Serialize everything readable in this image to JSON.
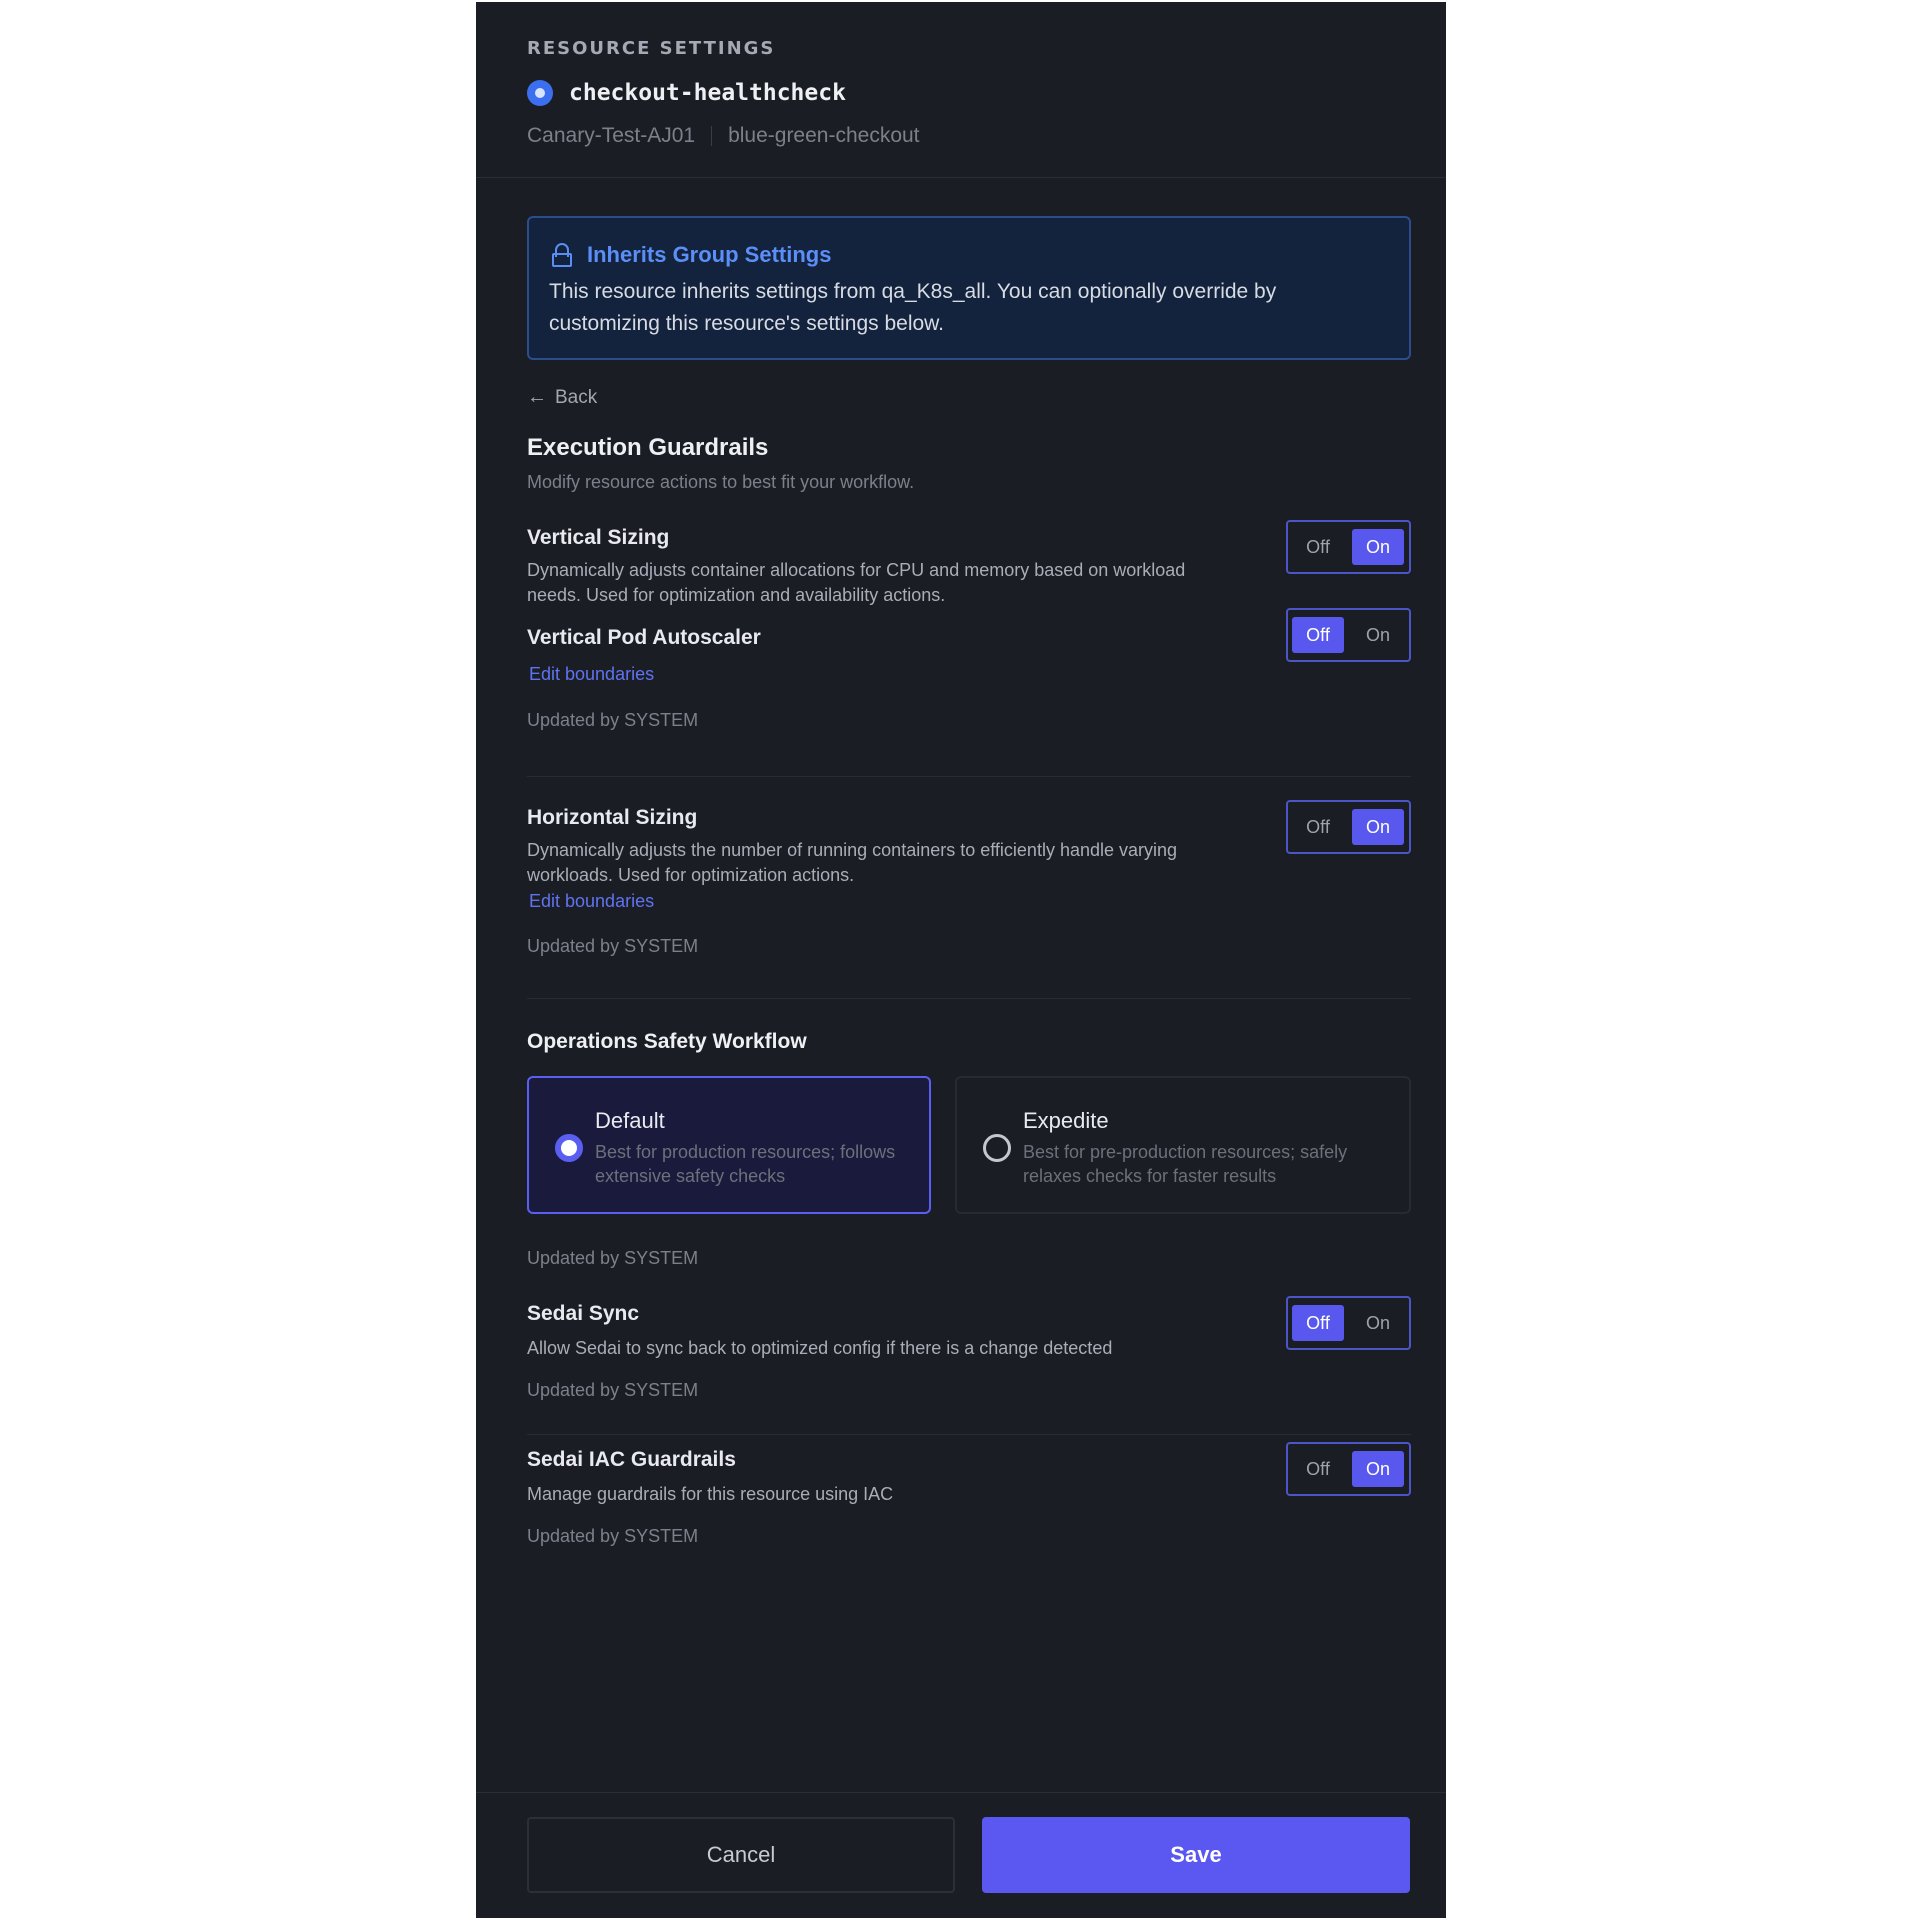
{
  "header": {
    "eyebrow": "RESOURCE SETTINGS",
    "resource_name": "checkout-healthcheck",
    "breadcrumbs": [
      "Canary-Test-AJ01",
      "blue-green-checkout"
    ]
  },
  "notice": {
    "title": "Inherits Group Settings",
    "text": "This resource inherits settings from qa_K8s_all. You can optionally override by customizing this resource's settings below."
  },
  "back_label": "Back",
  "section": {
    "title": "Execution Guardrails",
    "subtitle": "Modify resource actions to best fit your workflow."
  },
  "toggle_labels": {
    "off": "Off",
    "on": "On"
  },
  "items": {
    "vertical_sizing": {
      "title": "Vertical Sizing",
      "desc": "Dynamically adjusts container allocations for CPU and memory based on workload needs. Used for optimization and availability actions.",
      "state": "On"
    },
    "vpa": {
      "title": "Vertical Pod Autoscaler",
      "link": "Edit boundaries",
      "updated": "Updated by SYSTEM",
      "state": "Off"
    },
    "horizontal_sizing": {
      "title": "Horizontal Sizing",
      "desc": "Dynamically adjusts the number of running containers to efficiently handle varying workloads. Used for optimization actions.",
      "link": "Edit boundaries",
      "updated": "Updated by SYSTEM",
      "state": "On"
    },
    "sedai_sync": {
      "title": "Sedai Sync",
      "desc": "Allow Sedai to sync back to optimized config if there is a change detected",
      "updated": "Updated by SYSTEM",
      "state": "Off"
    },
    "iac_guardrails": {
      "title": "Sedai IAC Guardrails",
      "desc": "Manage guardrails for this resource using IAC",
      "updated": "Updated by SYSTEM",
      "state": "On"
    }
  },
  "workflow": {
    "title": "Operations Safety Workflow",
    "options": [
      {
        "label": "Default",
        "desc": "Best for production resources; follows extensive safety checks",
        "selected": true
      },
      {
        "label": "Expedite",
        "desc": "Best for pre-production resources; safely relaxes checks for faster results",
        "selected": false
      }
    ],
    "updated": "Updated by SYSTEM"
  },
  "footer": {
    "cancel": "Cancel",
    "save": "Save"
  },
  "colors": {
    "panel_bg": "#1b1d24",
    "accent": "#5858ee",
    "link": "#5f73f0",
    "notice_bg": "#13223d",
    "notice_border": "#2b4d8e"
  }
}
